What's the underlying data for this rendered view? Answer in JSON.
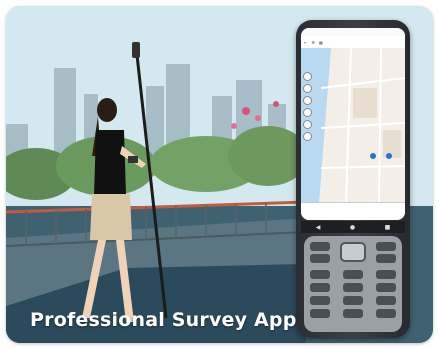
{
  "caption": "Professional Survey App",
  "device": {
    "brand_colors": {
      "body": "#2f3237",
      "keypad": "#9aa0a6",
      "screen_map": "#f3efe8"
    },
    "icons": [
      "back-icon",
      "home-icon",
      "menu-icon"
    ]
  },
  "colors": {
    "sky": "#cfe6ee",
    "water": "#3c5a6a",
    "railing": "#c25b3f"
  }
}
